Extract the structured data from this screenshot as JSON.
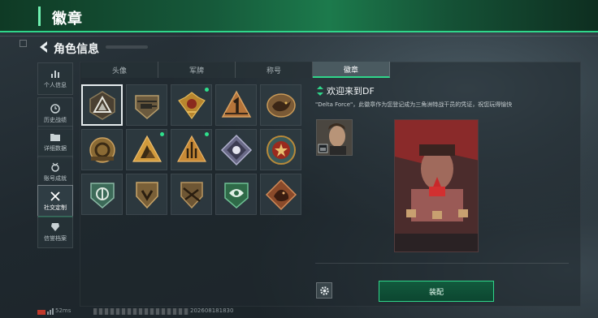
{
  "topbar": {
    "title": "徽章"
  },
  "header": {
    "title": "角色信息"
  },
  "nav": [
    {
      "label": "个人信息",
      "icon": "bar-chart-icon",
      "active": false
    },
    {
      "label": "历史战绩",
      "icon": "record-clock-icon",
      "active": false
    },
    {
      "label": "详细数据",
      "icon": "folder-icon",
      "active": false
    },
    {
      "label": "账号成就",
      "icon": "medal-icon",
      "active": false
    },
    {
      "label": "社交定制",
      "icon": "crossed-tools-icon",
      "active": true
    },
    {
      "label": "信誉档案",
      "icon": "shield-check-icon",
      "active": false
    }
  ],
  "tabs": [
    {
      "label": "头像",
      "active": false
    },
    {
      "label": "军牌",
      "active": false
    },
    {
      "label": "称号",
      "active": false
    },
    {
      "label": "徽章",
      "active": true
    }
  ],
  "badges": [
    {
      "name": "delta-force-welcome-badge",
      "selected": true,
      "new": false
    },
    {
      "name": "helicopter-badge",
      "selected": false,
      "new": false
    },
    {
      "name": "eagle-crown-badge",
      "selected": false,
      "new": true
    },
    {
      "name": "number-one-badge",
      "selected": false,
      "new": false
    },
    {
      "name": "dragon-oval-badge",
      "selected": false,
      "new": false
    },
    {
      "name": "gear-crest-badge",
      "selected": false,
      "new": false
    },
    {
      "name": "mountain-gold-badge",
      "selected": false,
      "new": true
    },
    {
      "name": "rocket-triangle-badge",
      "selected": false,
      "new": true
    },
    {
      "name": "rose-diamond-badge",
      "selected": false,
      "new": false
    },
    {
      "name": "star-circle-badge",
      "selected": false,
      "new": false
    },
    {
      "name": "green-emblem-badge",
      "selected": false,
      "new": false
    },
    {
      "name": "scout-shield-badge",
      "selected": false,
      "new": false
    },
    {
      "name": "rifle-shield-badge",
      "selected": false,
      "new": false
    },
    {
      "name": "green-hex-badge",
      "selected": false,
      "new": false
    },
    {
      "name": "dragon-diamond-badge",
      "selected": false,
      "new": false
    }
  ],
  "detail": {
    "title": "欢迎来到DF",
    "description": "\"Delta Force\"，此徽章作为您登记成为三角洲特战干员的凭证，祝您玩得愉快",
    "equip_label": "装配"
  },
  "footer": {
    "ping": "52ms",
    "uid": "202608181830"
  },
  "colors": {
    "accent": "#2fd68a",
    "topbar": "#16593a"
  }
}
